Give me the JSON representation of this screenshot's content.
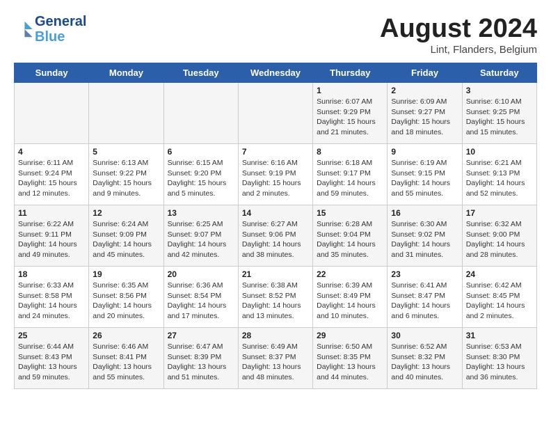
{
  "header": {
    "logo_line1": "General",
    "logo_line2": "Blue",
    "month": "August 2024",
    "location": "Lint, Flanders, Belgium"
  },
  "days_of_week": [
    "Sunday",
    "Monday",
    "Tuesday",
    "Wednesday",
    "Thursday",
    "Friday",
    "Saturday"
  ],
  "weeks": [
    [
      {
        "day": "",
        "info": ""
      },
      {
        "day": "",
        "info": ""
      },
      {
        "day": "",
        "info": ""
      },
      {
        "day": "",
        "info": ""
      },
      {
        "day": "1",
        "info": "Sunrise: 6:07 AM\nSunset: 9:29 PM\nDaylight: 15 hours\nand 21 minutes."
      },
      {
        "day": "2",
        "info": "Sunrise: 6:09 AM\nSunset: 9:27 PM\nDaylight: 15 hours\nand 18 minutes."
      },
      {
        "day": "3",
        "info": "Sunrise: 6:10 AM\nSunset: 9:25 PM\nDaylight: 15 hours\nand 15 minutes."
      }
    ],
    [
      {
        "day": "4",
        "info": "Sunrise: 6:11 AM\nSunset: 9:24 PM\nDaylight: 15 hours\nand 12 minutes."
      },
      {
        "day": "5",
        "info": "Sunrise: 6:13 AM\nSunset: 9:22 PM\nDaylight: 15 hours\nand 9 minutes."
      },
      {
        "day": "6",
        "info": "Sunrise: 6:15 AM\nSunset: 9:20 PM\nDaylight: 15 hours\nand 5 minutes."
      },
      {
        "day": "7",
        "info": "Sunrise: 6:16 AM\nSunset: 9:19 PM\nDaylight: 15 hours\nand 2 minutes."
      },
      {
        "day": "8",
        "info": "Sunrise: 6:18 AM\nSunset: 9:17 PM\nDaylight: 14 hours\nand 59 minutes."
      },
      {
        "day": "9",
        "info": "Sunrise: 6:19 AM\nSunset: 9:15 PM\nDaylight: 14 hours\nand 55 minutes."
      },
      {
        "day": "10",
        "info": "Sunrise: 6:21 AM\nSunset: 9:13 PM\nDaylight: 14 hours\nand 52 minutes."
      }
    ],
    [
      {
        "day": "11",
        "info": "Sunrise: 6:22 AM\nSunset: 9:11 PM\nDaylight: 14 hours\nand 49 minutes."
      },
      {
        "day": "12",
        "info": "Sunrise: 6:24 AM\nSunset: 9:09 PM\nDaylight: 14 hours\nand 45 minutes."
      },
      {
        "day": "13",
        "info": "Sunrise: 6:25 AM\nSunset: 9:07 PM\nDaylight: 14 hours\nand 42 minutes."
      },
      {
        "day": "14",
        "info": "Sunrise: 6:27 AM\nSunset: 9:06 PM\nDaylight: 14 hours\nand 38 minutes."
      },
      {
        "day": "15",
        "info": "Sunrise: 6:28 AM\nSunset: 9:04 PM\nDaylight: 14 hours\nand 35 minutes."
      },
      {
        "day": "16",
        "info": "Sunrise: 6:30 AM\nSunset: 9:02 PM\nDaylight: 14 hours\nand 31 minutes."
      },
      {
        "day": "17",
        "info": "Sunrise: 6:32 AM\nSunset: 9:00 PM\nDaylight: 14 hours\nand 28 minutes."
      }
    ],
    [
      {
        "day": "18",
        "info": "Sunrise: 6:33 AM\nSunset: 8:58 PM\nDaylight: 14 hours\nand 24 minutes."
      },
      {
        "day": "19",
        "info": "Sunrise: 6:35 AM\nSunset: 8:56 PM\nDaylight: 14 hours\nand 20 minutes."
      },
      {
        "day": "20",
        "info": "Sunrise: 6:36 AM\nSunset: 8:54 PM\nDaylight: 14 hours\nand 17 minutes."
      },
      {
        "day": "21",
        "info": "Sunrise: 6:38 AM\nSunset: 8:52 PM\nDaylight: 14 hours\nand 13 minutes."
      },
      {
        "day": "22",
        "info": "Sunrise: 6:39 AM\nSunset: 8:49 PM\nDaylight: 14 hours\nand 10 minutes."
      },
      {
        "day": "23",
        "info": "Sunrise: 6:41 AM\nSunset: 8:47 PM\nDaylight: 14 hours\nand 6 minutes."
      },
      {
        "day": "24",
        "info": "Sunrise: 6:42 AM\nSunset: 8:45 PM\nDaylight: 14 hours\nand 2 minutes."
      }
    ],
    [
      {
        "day": "25",
        "info": "Sunrise: 6:44 AM\nSunset: 8:43 PM\nDaylight: 13 hours\nand 59 minutes."
      },
      {
        "day": "26",
        "info": "Sunrise: 6:46 AM\nSunset: 8:41 PM\nDaylight: 13 hours\nand 55 minutes."
      },
      {
        "day": "27",
        "info": "Sunrise: 6:47 AM\nSunset: 8:39 PM\nDaylight: 13 hours\nand 51 minutes."
      },
      {
        "day": "28",
        "info": "Sunrise: 6:49 AM\nSunset: 8:37 PM\nDaylight: 13 hours\nand 48 minutes."
      },
      {
        "day": "29",
        "info": "Sunrise: 6:50 AM\nSunset: 8:35 PM\nDaylight: 13 hours\nand 44 minutes."
      },
      {
        "day": "30",
        "info": "Sunrise: 6:52 AM\nSunset: 8:32 PM\nDaylight: 13 hours\nand 40 minutes."
      },
      {
        "day": "31",
        "info": "Sunrise: 6:53 AM\nSunset: 8:30 PM\nDaylight: 13 hours\nand 36 minutes."
      }
    ]
  ]
}
